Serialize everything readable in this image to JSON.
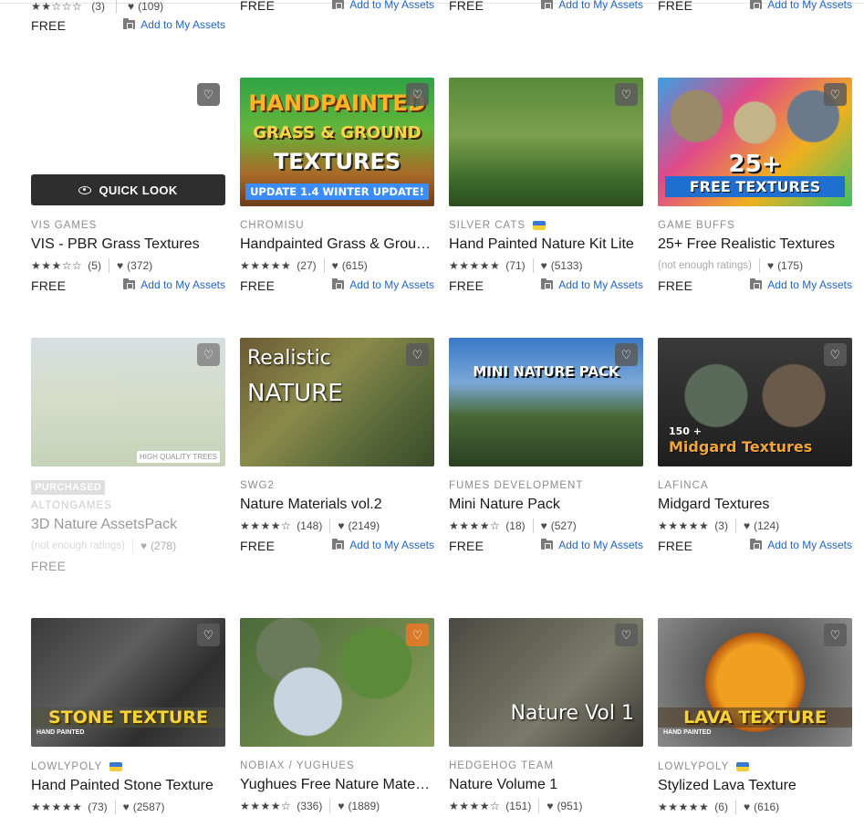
{
  "colors": {
    "link": "#2364c8",
    "purchased_bg": "#dedede",
    "quicklook_bg": "#2e2e2e"
  },
  "icons": {
    "heart": "heart-icon",
    "folder": "folder-icon",
    "eye": "eye-icon",
    "flag": "ukraine-flag-icon"
  },
  "common": {
    "free": "FREE",
    "add_to_assets": "Add to My Assets",
    "quick_look": "QUICK LOOK",
    "purchased": "PURCHASED",
    "not_enough": "(not enough ratings)"
  },
  "top_row": [
    {
      "stars": "★★☆☆☆",
      "count": "(3)",
      "likes": "(109)",
      "price": "FREE"
    },
    {
      "price": "FREE"
    },
    {
      "price": "FREE"
    },
    {
      "price": "FREE"
    }
  ],
  "cards": [
    {
      "publisher": "VIS GAMES",
      "title": "VIS - PBR Grass Textures",
      "stars": "★★★☆☆",
      "rating_count": "(5)",
      "likes": "(372)",
      "price": "FREE"
    },
    {
      "publisher": "CHROMISU",
      "title": "Handpainted Grass & Ground Textures",
      "stars": "★★★★★",
      "rating_count": "(27)",
      "likes": "(615)",
      "price": "FREE",
      "thumb_lines": [
        "HANDPAINTED",
        "GRASS & GROUND",
        "TEXTURES",
        "UPDATE 1.4 WINTER UPDATE!"
      ]
    },
    {
      "publisher": "SILVER CATS",
      "title": "Hand Painted Nature Kit Lite",
      "stars": "★★★★★",
      "rating_count": "(71)",
      "likes": "(5133)",
      "price": "FREE"
    },
    {
      "publisher": "GAME BUFFS",
      "title": "25+ Free Realistic Textures",
      "likes": "(175)",
      "price": "FREE",
      "thumb_lines": [
        "25+",
        "FREE TEXTURES"
      ]
    },
    {
      "publisher": "ALTONGAMES",
      "title": "3D Nature AssetsPack",
      "likes": "(278)",
      "price": "FREE",
      "thumb_lines": [
        "HIGH QUALITY TREES"
      ]
    },
    {
      "publisher": "SWG2",
      "title": "Nature Materials vol.2",
      "stars": "★★★★☆",
      "rating_count": "(148)",
      "likes": "(2149)",
      "price": "FREE",
      "thumb_lines": [
        "Realistic",
        "NATURE"
      ]
    },
    {
      "publisher": "FUMES DEVELOPMENT",
      "title": "Mini Nature Pack",
      "stars": "★★★★☆",
      "rating_count": "(18)",
      "likes": "(527)",
      "price": "FREE",
      "thumb_lines": [
        "MINI NATURE PACK"
      ]
    },
    {
      "publisher": "LAFINCA",
      "title": "Midgard Textures",
      "stars": "★★★★★",
      "rating_count": "(3)",
      "likes": "(124)",
      "price": "FREE",
      "thumb_lines": [
        "150 +",
        "Midgard Textures"
      ]
    },
    {
      "publisher": "LOWLYPOLY",
      "title": "Hand Painted Stone Texture",
      "stars": "★★★★★",
      "rating_count": "(73)",
      "likes": "(2587)",
      "thumb_lines": [
        "STONE TEXTURE",
        "HAND PAINTED"
      ]
    },
    {
      "publisher": "NOBIAX / YUGHUES",
      "title": "Yughues Free Nature Materials",
      "stars": "★★★★☆",
      "rating_count": "(336)",
      "likes": "(1889)"
    },
    {
      "publisher": "HEDGEHOG TEAM",
      "title": "Nature Volume 1",
      "stars": "★★★★☆",
      "rating_count": "(151)",
      "likes": "(951)",
      "thumb_lines": [
        "Nature Vol 1"
      ]
    },
    {
      "publisher": "LOWLYPOLY",
      "title": "Stylized Lava Texture",
      "stars": "★★★★★",
      "rating_count": "(6)",
      "likes": "(616)",
      "thumb_lines": [
        "LAVA TEXTURE",
        "HAND PAINTED"
      ]
    }
  ]
}
